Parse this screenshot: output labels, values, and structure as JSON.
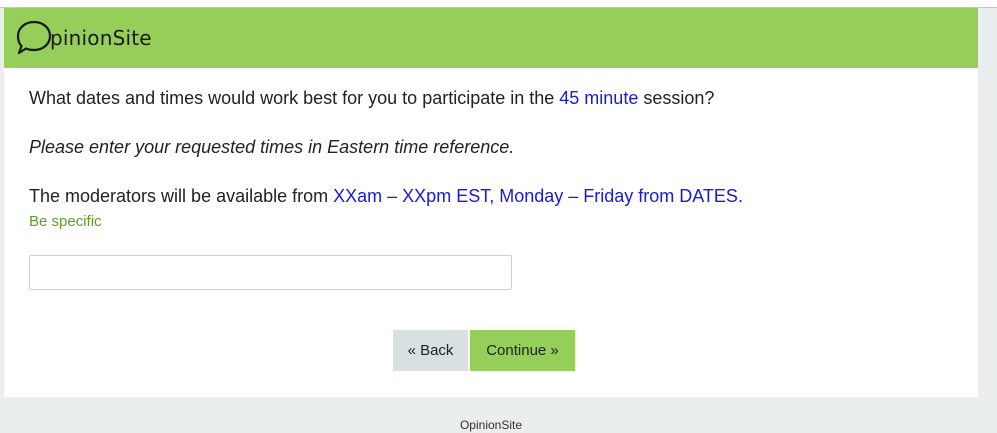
{
  "site": {
    "brand": "OpinionSite",
    "logo_text": "pinionSite",
    "accent_color": "#95cf5a",
    "highlight_color": "#1a1adb"
  },
  "question": {
    "line1": {
      "prefix": "What dates and times would work best for you to participate in the ",
      "highlight": "45 minute",
      "suffix": " session?"
    },
    "instruction": "Please enter your requested times in Eastern time reference.",
    "line3": {
      "prefix": "The moderators will be available from ",
      "highlight": "XXam – XXpm EST, Monday – Friday from DATES."
    },
    "hint": "Be specific"
  },
  "answer_field": {
    "value": "",
    "placeholder": ""
  },
  "buttons": {
    "back_label": "« Back",
    "continue_label": "Continue »"
  },
  "footer": {
    "text": "OpinionSite"
  }
}
